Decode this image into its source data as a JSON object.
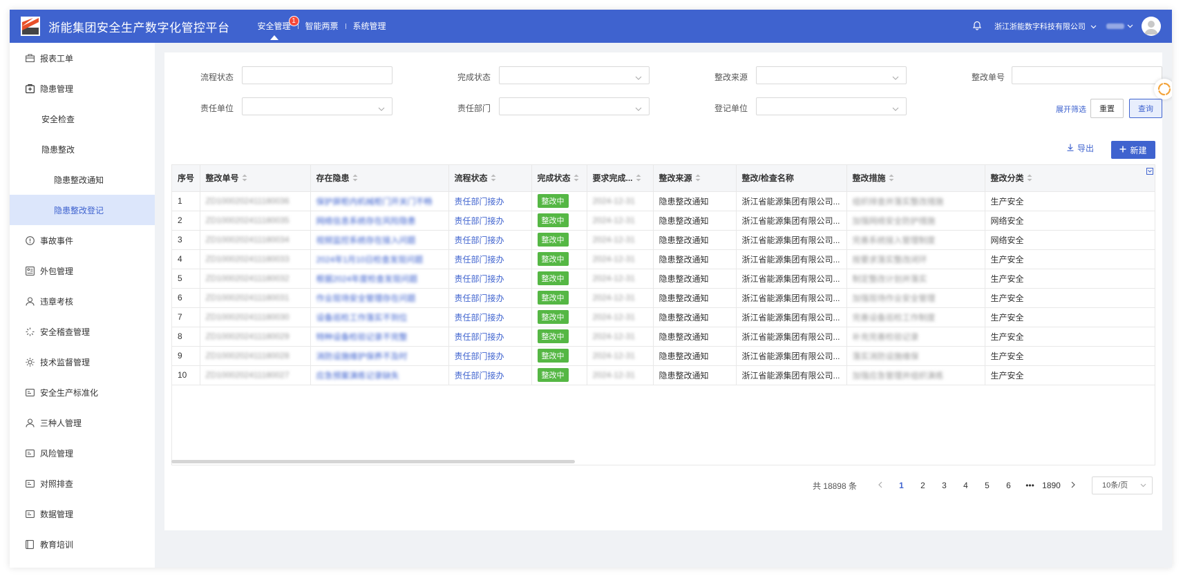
{
  "header": {
    "title": "浙能集团安全生产数字化管控平台",
    "nav": [
      {
        "label": "安全管理",
        "badge": "1"
      },
      {
        "label": "智能两票"
      },
      {
        "label": "系统管理"
      }
    ],
    "company": "浙江浙能数字科技有限公司"
  },
  "sidebar": {
    "items": [
      {
        "label": "报表工单",
        "icon": "briefcase-icon"
      },
      {
        "label": "隐患管理",
        "icon": "plus-box-icon"
      },
      {
        "label": "安全检查"
      },
      {
        "label": "隐患整改"
      },
      {
        "label": "隐患整改通知"
      },
      {
        "label": "隐患整改登记"
      },
      {
        "label": "事故事件",
        "icon": "alert-circle-icon"
      },
      {
        "label": "外包管理",
        "icon": "outsource-icon"
      },
      {
        "label": "违章考核",
        "icon": "user-icon"
      },
      {
        "label": "安全稽查管理",
        "icon": "spinner-icon"
      },
      {
        "label": "技术监督管理",
        "icon": "sun-icon"
      },
      {
        "label": "安全生产标准化",
        "icon": "card-icon"
      },
      {
        "label": "三种人管理",
        "icon": "person-icon"
      },
      {
        "label": "风险管理",
        "icon": "card-icon"
      },
      {
        "label": "对照排查",
        "icon": "card-icon"
      },
      {
        "label": "数据管理",
        "icon": "card-icon"
      },
      {
        "label": "教育培训",
        "icon": "book-icon"
      }
    ]
  },
  "filters": {
    "process_status": "流程状态",
    "completion_status": "完成状态",
    "rectify_source": "整改来源",
    "rectify_no": "整改单号",
    "resp_unit": "责任单位",
    "resp_dept": "责任部门",
    "reg_unit": "登记单位",
    "expand": "展开筛选",
    "reset": "重置",
    "query": "查询"
  },
  "toolbar": {
    "export": "导出",
    "new": "新建"
  },
  "table": {
    "columns": [
      "序号",
      "整改单号",
      "存在隐患",
      "流程状态",
      "完成状态",
      "要求完成...",
      "整改来源",
      "整改/检查名称",
      "整改措施",
      "整改分类"
    ],
    "rows": [
      {
        "no": "1",
        "code": "ZD1000202411180036",
        "hazard": "保护屏柜内机械柜门开关门不畅",
        "process": "责任部门接办",
        "done": "整改中",
        "due": "2024-12-31",
        "source": "隐患整改通知",
        "name": "浙江省能源集团有限公司...",
        "measure": "组织排查并落实整改措施",
        "category": "生产安全"
      },
      {
        "no": "2",
        "code": "ZD1000202411180035",
        "hazard": "网络信息系统存在风险隐患",
        "process": "责任部门接办",
        "done": "整改中",
        "due": "2024-12-31",
        "source": "隐患整改通知",
        "name": "浙江省能源集团有限公司...",
        "measure": "加强网络安全防护措施",
        "category": "网络安全"
      },
      {
        "no": "3",
        "code": "ZD1000202411180034",
        "hazard": "视频监控系统存在接入问题",
        "process": "责任部门接办",
        "done": "整改中",
        "due": "2024-12-31",
        "source": "隐患整改通知",
        "name": "浙江省能源集团有限公司...",
        "measure": "完善系统接入管理制度",
        "category": "网络安全"
      },
      {
        "no": "4",
        "code": "ZD1000202411180033",
        "hazard": "2024年1月10日检查发现问题",
        "process": "责任部门接办",
        "done": "整改中",
        "due": "2024-12-31",
        "source": "隐患整改通知",
        "name": "浙江省能源集团有限公司...",
        "measure": "按要求落实整改闭环",
        "category": "生产安全"
      },
      {
        "no": "5",
        "code": "ZD1000202411180032",
        "hazard": "根据2024年度检查发现问题",
        "process": "责任部门接办",
        "done": "整改中",
        "due": "2024-12-31",
        "source": "隐患整改通知",
        "name": "浙江省能源集团有限公司...",
        "measure": "制定整改计划并落实",
        "category": "生产安全"
      },
      {
        "no": "6",
        "code": "ZD1000202411180031",
        "hazard": "作业现场安全管理存在问题",
        "process": "责任部门接办",
        "done": "整改中",
        "due": "2024-12-31",
        "source": "隐患整改通知",
        "name": "浙江省能源集团有限公司...",
        "measure": "加强现场作业安全管理",
        "category": "生产安全"
      },
      {
        "no": "7",
        "code": "ZD1000202411180030",
        "hazard": "设备巡检工作落实不到位",
        "process": "责任部门接办",
        "done": "整改中",
        "due": "2024-12-31",
        "source": "隐患整改通知",
        "name": "浙江省能源集团有限公司...",
        "measure": "完善设备巡检工作制度",
        "category": "生产安全"
      },
      {
        "no": "8",
        "code": "ZD1000202411180029",
        "hazard": "特种设备检验记录不完整",
        "process": "责任部门接办",
        "done": "整改中",
        "due": "2024-12-31",
        "source": "隐患整改通知",
        "name": "浙江省能源集团有限公司...",
        "measure": "补充完善检验记录",
        "category": "生产安全"
      },
      {
        "no": "9",
        "code": "ZD1000202411180028",
        "hazard": "消防设施维护保养不及时",
        "process": "责任部门接办",
        "done": "整改中",
        "due": "2024-12-31",
        "source": "隐患整改通知",
        "name": "浙江省能源集团有限公司...",
        "measure": "落实消防设施维保",
        "category": "生产安全"
      },
      {
        "no": "10",
        "code": "ZD1000202411180027",
        "hazard": "应急预案演练记录缺失",
        "process": "责任部门接办",
        "done": "整改中",
        "due": "2024-12-31",
        "source": "隐患整改通知",
        "name": "浙江省能源集团有限公司...",
        "measure": "加强应急管理并组织演练",
        "category": "生产安全"
      }
    ]
  },
  "pagination": {
    "total": "共 18898 条",
    "pages": [
      "1",
      "2",
      "3",
      "4",
      "5",
      "6"
    ],
    "ellipsis": "•••",
    "last": "1890",
    "page_size": "10条/页"
  },
  "colors": {
    "primary": "#3f63cf",
    "tag_green": "#55b744",
    "badge_red": "#f5483b"
  }
}
